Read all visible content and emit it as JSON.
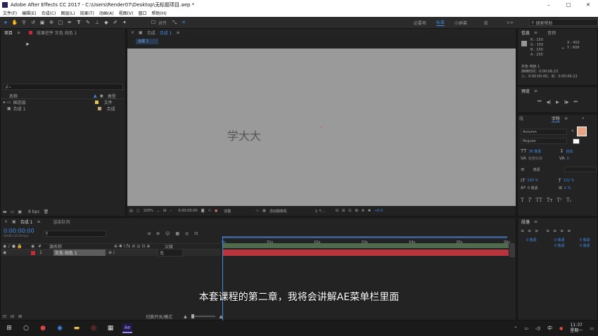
{
  "app": {
    "title": "Adobe After Effects CC 2017 - C:\\Users\\Render07\\Desktop\\无标题项目.aep *"
  },
  "menu": [
    "文件(F)",
    "编辑(E)",
    "合成(C)",
    "图层(L)",
    "效果(T)",
    "动画(A)",
    "视图(V)",
    "窗口",
    "帮助(H)"
  ],
  "toolbar": {
    "align_label": "对齐",
    "workspaces": [
      "必要项",
      "标准",
      "小屏幕",
      "库"
    ],
    "active_workspace": "标准",
    "more": ">>",
    "search_placeholder": "搜索帮助"
  },
  "project": {
    "tab": "项目",
    "effect_tab": "效果控件 灰色 纯色 1",
    "search_icon": "ρ⌄",
    "col_name": "名称",
    "col_type": "类型",
    "items": [
      {
        "name": "固态层",
        "type": "文件",
        "icon": "folder-icon"
      },
      {
        "name": "合成 1",
        "type": "合成",
        "icon": "composition-icon"
      }
    ],
    "bpc": "8 bpc"
  },
  "comp": {
    "tab": "合成",
    "tab_name": "合成 1",
    "breadcrumb": "合成 1",
    "canvas_text": "学大大",
    "zoom": "100%",
    "time": "0:00:00:00",
    "resolution": "完整",
    "camera": "活动摄像机",
    "views": "1 个...",
    "offset": "+0.0"
  },
  "info": {
    "tab": "信息",
    "audio_tab": "音频",
    "r": "R : 150",
    "g": "G : 150",
    "b": "B : 150",
    "a": "A : 255",
    "x": "X : 402",
    "y": "Y : 609",
    "layer": "灰色 纯色 1",
    "duration": "持续时间：0:00:06:23",
    "inout": "入：0:00:00:00，出：0:00:06:22",
    "swatch_color": "#969696"
  },
  "preview": {
    "tab": "预览",
    "buttons": [
      "⏮",
      "◀|",
      "▶",
      "|▶",
      "⏭"
    ]
  },
  "character": {
    "tab_left": "段",
    "tab": "字符",
    "font": "Autumn",
    "style": "Regular",
    "size": "36 像素",
    "leading": "自动",
    "kerning": "度量标准",
    "tracking": "0",
    "stroke": "像素",
    "vscale": "100 %",
    "hscale": "132 %",
    "baseline": "0 像素",
    "tsume": "0 %",
    "styles": [
      "T",
      "T",
      "TT",
      "Tт",
      "T¹",
      "T₁"
    ],
    "fill_color": "#e8a583"
  },
  "paragraph": {
    "tab": "段落",
    "indent_values": [
      "0 像素",
      "0 像素",
      "0 像素",
      "0 像素",
      "0 像素"
    ]
  },
  "timeline": {
    "tab": "合成 1",
    "render_tab": "渲染队列",
    "timecode": "0:00:00:00",
    "timecode_sub": "00000 (25.00 fps)",
    "col_num": "#",
    "col_source": "源名称",
    "col_parent": "父级",
    "layer_num": "1",
    "layer_name": "灰色 纯色 1",
    "parent": "无",
    "ticks": [
      "0s",
      "01s",
      "02s",
      "03s",
      "04s",
      "05s",
      "06s"
    ],
    "switch_label": "切换开关/模式"
  },
  "subtitle": "本套课程的第二章，我将会讲解AE菜单栏里面",
  "taskbar": {
    "time": "11:37",
    "day": "星期一",
    "ime": "中",
    "lang_icon": "中"
  }
}
